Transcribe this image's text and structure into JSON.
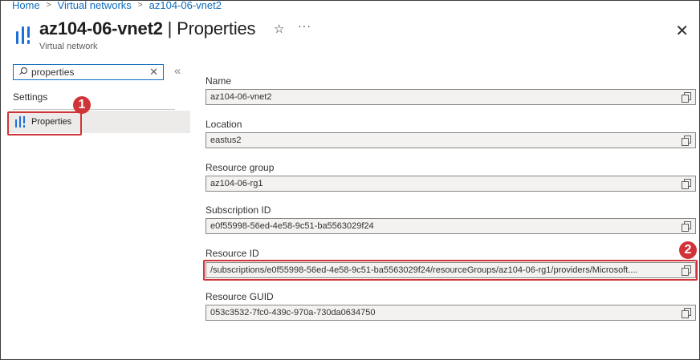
{
  "breadcrumb": [
    {
      "label": "Home"
    },
    {
      "label": "Virtual networks"
    },
    {
      "label": "az104-06-vnet2"
    }
  ],
  "breadcrumb_separator": ">",
  "header": {
    "resource_name": "az104-06-vnet2",
    "page_suffix": " | Properties",
    "subtitle": "Virtual network",
    "star_icon": "☆",
    "more_icon": "···",
    "close_icon": "✕"
  },
  "sidebar": {
    "search_value": "properties",
    "clear_icon": "✕",
    "collapse_icon": "«",
    "section_label": "Settings",
    "items": [
      {
        "label": "Properties",
        "selected": true
      }
    ]
  },
  "callouts": [
    {
      "number": "1"
    },
    {
      "number": "2"
    }
  ],
  "properties": [
    {
      "label": "Name",
      "value": "az104-06-vnet2"
    },
    {
      "label": "Location",
      "value": "eastus2"
    },
    {
      "label": "Resource group",
      "value": "az104-06-rg1"
    },
    {
      "label": "Subscription ID",
      "value": "e0f55998-56ed-4e58-9c51-ba5563029f24"
    },
    {
      "label": "Resource ID",
      "value": "/subscriptions/e0f55998-56ed-4e58-9c51-ba5563029f24/resourceGroups/az104-06-rg1/providers/Microsoft...."
    },
    {
      "label": "Resource GUID",
      "value": "053c3532-7fc0-439c-970a-730da0634750"
    }
  ],
  "colors": {
    "accent": "#0f6cbd",
    "icon_blue": "#1e6fd9",
    "callout_red": "#d13438"
  }
}
